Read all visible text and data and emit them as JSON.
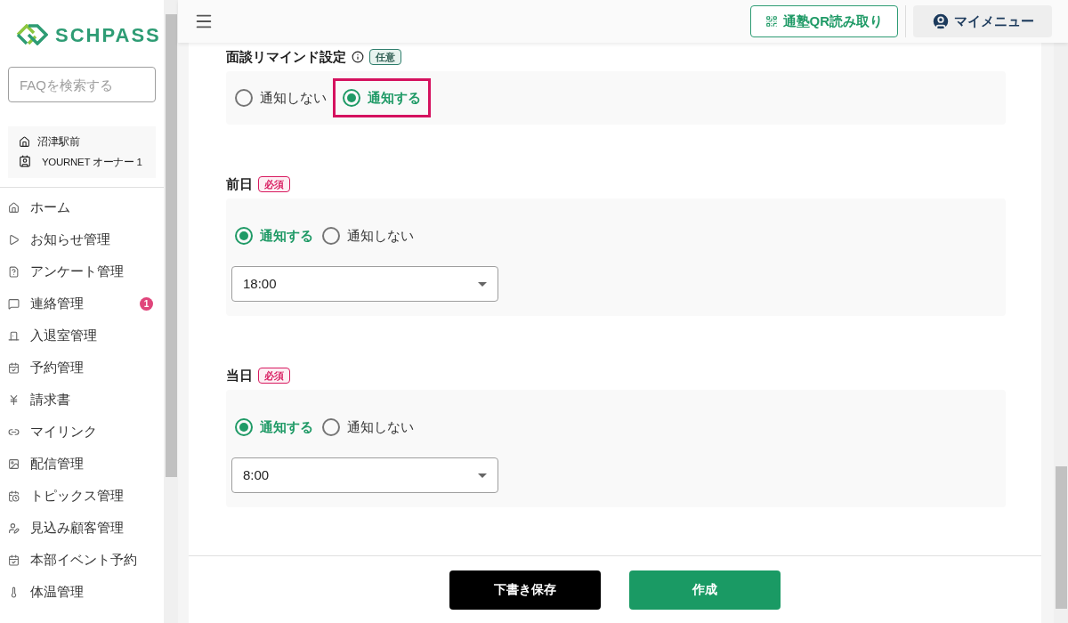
{
  "sidebar": {
    "logo": "SCHPASS",
    "search": {
      "placeholder": "FAQを検索する"
    },
    "school": "沼津駅前",
    "user": "YOURNET オーナー 1",
    "items": [
      {
        "label": "ホーム"
      },
      {
        "label": "お知らせ管理"
      },
      {
        "label": "アンケート管理"
      },
      {
        "label": "連絡管理",
        "badge": "1"
      },
      {
        "label": "入退室管理"
      },
      {
        "label": "予約管理"
      },
      {
        "label": "請求書"
      },
      {
        "label": "マイリンク"
      },
      {
        "label": "配信管理"
      },
      {
        "label": "トピックス管理"
      },
      {
        "label": "見込み顧客管理"
      },
      {
        "label": "本部イベント予約"
      },
      {
        "label": "体温管理"
      }
    ]
  },
  "header": {
    "qr_button": "通塾QR読み取り",
    "my_menu": "マイメニュー"
  },
  "sections": [
    {
      "title": "面談リマインド設定",
      "info": true,
      "badge": {
        "kind": "optional",
        "label": "任意"
      },
      "options": [
        {
          "label": "通知しない",
          "selected": false,
          "highlighted": false
        },
        {
          "label": "通知する",
          "selected": true,
          "highlighted": true
        }
      ]
    },
    {
      "title": "前日",
      "info": false,
      "badge": {
        "kind": "required",
        "label": "必須"
      },
      "options": [
        {
          "label": "通知する",
          "selected": true,
          "highlighted": false
        },
        {
          "label": "通知しない",
          "selected": false,
          "highlighted": false
        }
      ],
      "select": {
        "value": "18:00"
      }
    },
    {
      "title": "当日",
      "info": false,
      "badge": {
        "kind": "required",
        "label": "必須"
      },
      "options": [
        {
          "label": "通知する",
          "selected": true,
          "highlighted": false
        },
        {
          "label": "通知しない",
          "selected": false,
          "highlighted": false
        }
      ],
      "select": {
        "value": "8:00"
      }
    }
  ],
  "footer": {
    "draft_button": "下書き保存",
    "create_button": "作成"
  }
}
